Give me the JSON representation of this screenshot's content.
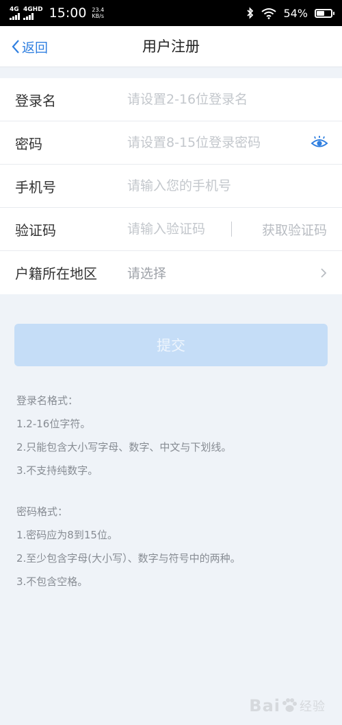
{
  "status_bar": {
    "sim1": "4G",
    "sim2": "4GHD",
    "time": "15:00",
    "speed_value": "23.4",
    "speed_unit": "KB/s",
    "battery_pct": "54%",
    "battery_level": 0.54
  },
  "nav": {
    "back_label": "返回",
    "title": "用户注册"
  },
  "form": {
    "login_name": {
      "label": "登录名",
      "placeholder": "请设置2-16位登录名"
    },
    "password": {
      "label": "密码",
      "placeholder": "请设置8-15位登录密码"
    },
    "phone": {
      "label": "手机号",
      "placeholder": "请输入您的手机号"
    },
    "code": {
      "label": "验证码",
      "placeholder": "请输入验证码",
      "button": "获取验证码"
    },
    "region": {
      "label": "户籍所在地区",
      "value": "请选择"
    }
  },
  "submit_label": "提交",
  "notes": {
    "login_title": "登录名格式：",
    "login_rules": [
      "1.2-16位字符。",
      "2.只能包含大小写字母、数字、中文与下划线。",
      "3.不支持纯数字。"
    ],
    "password_title": "密码格式：",
    "password_rules": [
      "1.密码应为8到15位。",
      "2.至少包含字母(大小写）、数字与符号中的两种。",
      "3.不包含空格。"
    ]
  },
  "watermark": {
    "main": "Bai",
    "sub": "经验"
  },
  "colors": {
    "accent": "#2f7fe0",
    "submit_disabled": "#c5ddf7",
    "page_bg": "#eff3f8"
  },
  "icons": {
    "back": "chevron-left-icon",
    "password_toggle": "eye-icon",
    "region_more": "chevron-right-icon"
  }
}
